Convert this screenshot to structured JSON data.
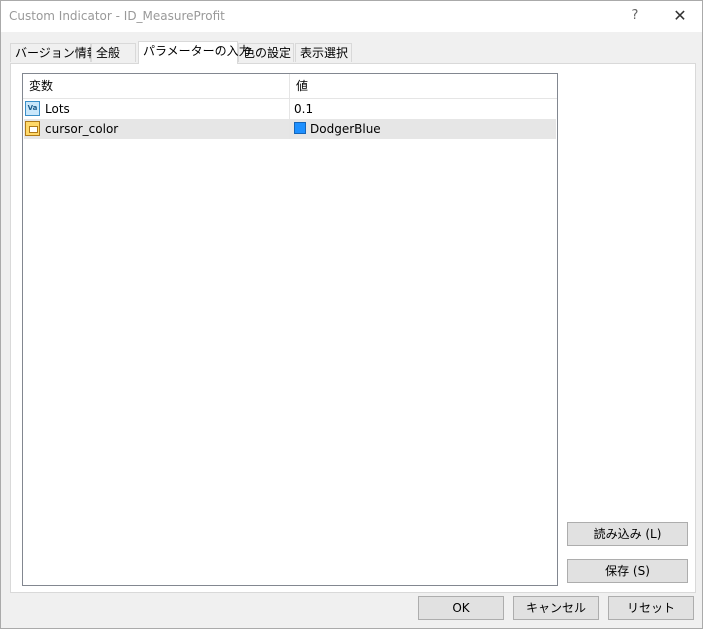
{
  "window": {
    "title": "Custom Indicator - ID_MeasureProfit",
    "help_glyph": "?",
    "close_glyph": "✕"
  },
  "tabs": [
    {
      "label": "バージョン情報",
      "active": false
    },
    {
      "label": "全般",
      "active": false
    },
    {
      "label": "パラメーターの入力",
      "active": true
    },
    {
      "label": "色の設定",
      "active": false
    },
    {
      "label": "表示選択",
      "active": false
    }
  ],
  "params": {
    "columns": [
      "変数",
      "値"
    ],
    "rows": [
      {
        "icon": "value-icon",
        "icon_text": "Va",
        "name": "Lots",
        "value": "0.1",
        "selected": false
      },
      {
        "icon": "color-icon",
        "name": "cursor_color",
        "value": "DodgerBlue",
        "swatch_color": "#1e90ff",
        "selected": true
      }
    ]
  },
  "side_buttons": {
    "load": "読み込み (L)",
    "save": "保存 (S)"
  },
  "footer_buttons": {
    "ok": "OK",
    "cancel": "キャンセル",
    "reset": "リセット"
  }
}
